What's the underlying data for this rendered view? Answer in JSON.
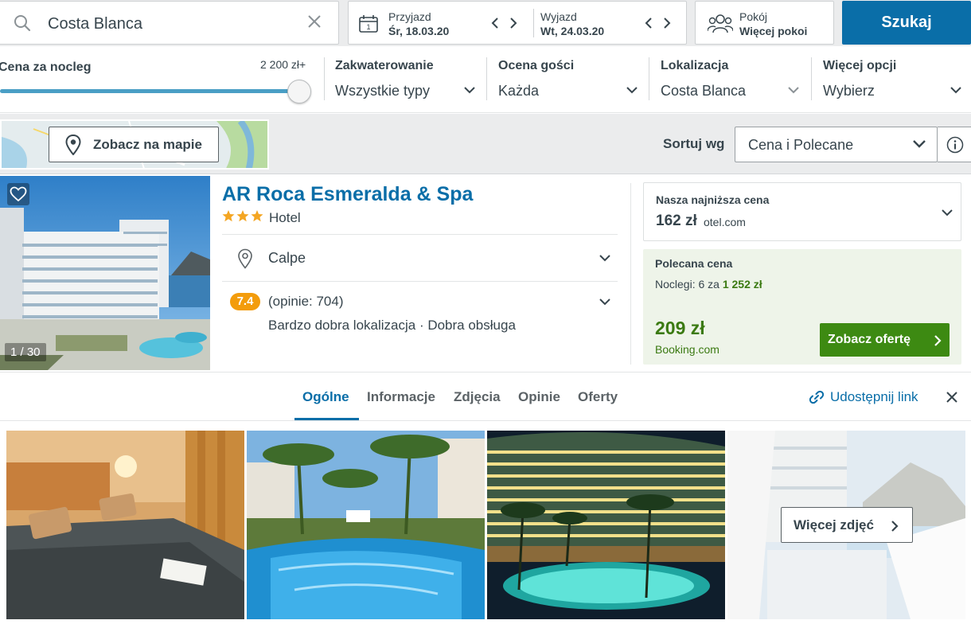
{
  "search": {
    "destination": "Costa Blanca",
    "checkin_label": "Przyjazd",
    "checkin_value": "Śr, 18.03.20",
    "checkout_label": "Wyjazd",
    "checkout_value": "Wt, 24.03.20",
    "room_label": "Pokój",
    "room_value": "Więcej pokoi",
    "search_button": "Szukaj"
  },
  "filters": {
    "price_label": "Cena za nocleg",
    "price_max": "2 200 zł+",
    "price_slider_fraction": 1.0,
    "accommodation_title": "Zakwaterowanie",
    "accommodation_value": "Wszystkie typy",
    "rating_title": "Ocena gości",
    "rating_value": "Każda",
    "location_title": "Lokalizacja",
    "location_value": "Costa Blanca",
    "more_title": "Więcej opcji",
    "more_value": "Wybierz"
  },
  "toolbar": {
    "map_button": "Zobacz na mapie",
    "sort_label": "Sortuj wg",
    "sort_value": "Cena i Polecane"
  },
  "hotel": {
    "image_count": "1 / 30",
    "name": "AR Roca Esmeralda & Spa",
    "stars": 3,
    "type": "Hotel",
    "location": "Calpe",
    "rating": "7.4",
    "reviews": "(opinie: 704)",
    "reviews_summary": "Bardzo dobra lokalizacja · Dobra obsługa",
    "lowest_title": "Nasza najniższa cena",
    "lowest_price": "162 zł",
    "lowest_provider": "otel.com",
    "featured_title": "Polecana cena",
    "featured_nights_prefix": "Noclegi: 6 za",
    "featured_nights_total": "1 252 zł",
    "featured_price": "209 zł",
    "featured_provider": "Booking.com",
    "offer_button": "Zobacz ofertę"
  },
  "tabs": {
    "items": [
      "Ogólne",
      "Informacje",
      "Zdjęcia",
      "Opinie",
      "Oferty"
    ],
    "active": "Ogólne",
    "share_link": "Udostępnij link"
  },
  "photos": {
    "more_button": "Więcej zdjęć"
  },
  "colors": {
    "brand_blue": "#0a6ea8",
    "rating_orange": "#f39c0c",
    "offer_green": "#3d8a12",
    "price_green": "#3b7a12",
    "star": "#f4a623"
  }
}
